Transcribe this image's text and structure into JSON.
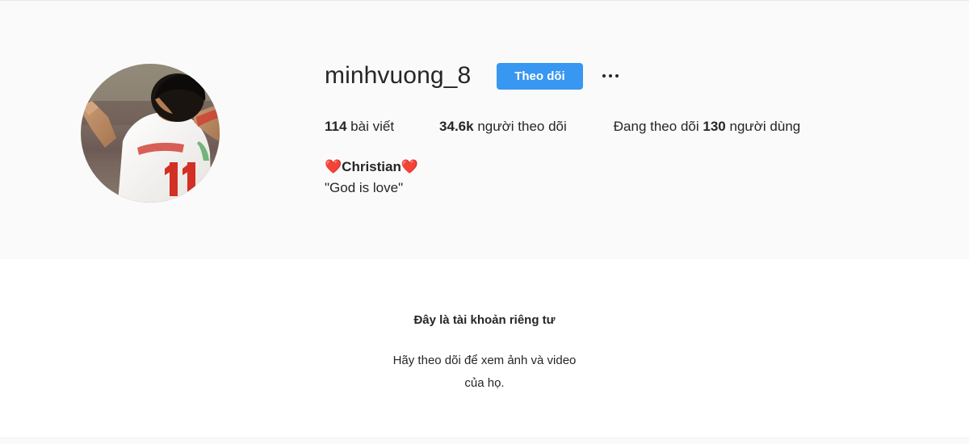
{
  "profile": {
    "username": "minhvuong_8",
    "follow_button_label": "Theo dõi",
    "options_icon": "ellipsis-horizontal-icon",
    "avatar": {
      "icon_name": "profile-avatar",
      "description": "Footballer in white jersey with red number 11, arms raised celebrating",
      "jersey_number": "11"
    },
    "stats": [
      {
        "name": "posts",
        "value": "114",
        "label": "bài viết",
        "order": "value-first"
      },
      {
        "name": "followers",
        "value": "34.6k",
        "label": "người theo dõi",
        "order": "value-first"
      },
      {
        "name": "following",
        "prefix": "Đang theo dõi",
        "value": "130",
        "label": "người dùng",
        "order": "prefix-value-label"
      }
    ],
    "bio": {
      "line1_emoji_left": "❤️",
      "line1_text": "Christian",
      "line1_emoji_right": "❤️",
      "line2": "\"God is love\""
    }
  },
  "private_notice": {
    "title": "Đây là tài khoản riêng tư",
    "subtitle_line1": "Hãy theo dõi để xem ảnh và video",
    "subtitle_line2": "của họ."
  },
  "colors": {
    "accent_blue": "#3897f0",
    "text_primary": "#262626",
    "header_bg": "#fafafa",
    "page_bg": "#ffffff",
    "divider": "#efefef"
  }
}
